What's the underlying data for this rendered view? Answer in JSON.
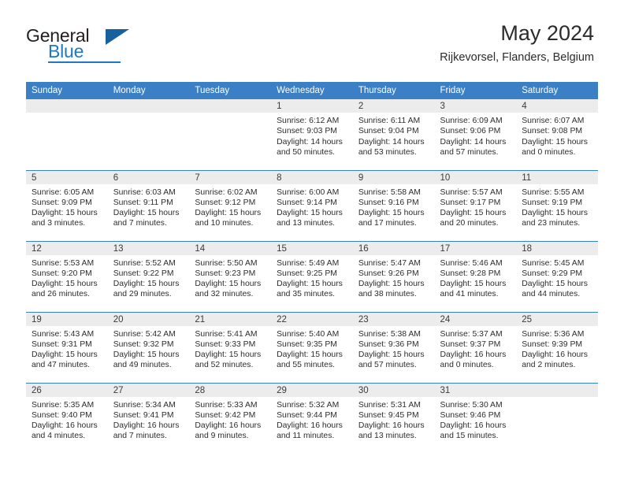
{
  "brand": {
    "name_line1": "General",
    "name_line2": "Blue",
    "logo_icon": "triangle-mark"
  },
  "header": {
    "title": "May 2024",
    "location": "Rijkevorsel, Flanders, Belgium"
  },
  "calendar": {
    "weekday_headers": [
      "Sunday",
      "Monday",
      "Tuesday",
      "Wednesday",
      "Thursday",
      "Friday",
      "Saturday"
    ],
    "header_bg": "#3b7fc4",
    "daynum_bg": "#ececec",
    "weeks": [
      [
        {
          "day": "",
          "empty": true,
          "sunrise": "",
          "sunset": "",
          "daylight_l1": "",
          "daylight_l2": ""
        },
        {
          "day": "",
          "empty": true,
          "sunrise": "",
          "sunset": "",
          "daylight_l1": "",
          "daylight_l2": ""
        },
        {
          "day": "",
          "empty": true,
          "sunrise": "",
          "sunset": "",
          "daylight_l1": "",
          "daylight_l2": ""
        },
        {
          "day": "1",
          "empty": false,
          "sunrise": "Sunrise: 6:12 AM",
          "sunset": "Sunset: 9:03 PM",
          "daylight_l1": "Daylight: 14 hours",
          "daylight_l2": "and 50 minutes."
        },
        {
          "day": "2",
          "empty": false,
          "sunrise": "Sunrise: 6:11 AM",
          "sunset": "Sunset: 9:04 PM",
          "daylight_l1": "Daylight: 14 hours",
          "daylight_l2": "and 53 minutes."
        },
        {
          "day": "3",
          "empty": false,
          "sunrise": "Sunrise: 6:09 AM",
          "sunset": "Sunset: 9:06 PM",
          "daylight_l1": "Daylight: 14 hours",
          "daylight_l2": "and 57 minutes."
        },
        {
          "day": "4",
          "empty": false,
          "sunrise": "Sunrise: 6:07 AM",
          "sunset": "Sunset: 9:08 PM",
          "daylight_l1": "Daylight: 15 hours",
          "daylight_l2": "and 0 minutes."
        }
      ],
      [
        {
          "day": "5",
          "empty": false,
          "sunrise": "Sunrise: 6:05 AM",
          "sunset": "Sunset: 9:09 PM",
          "daylight_l1": "Daylight: 15 hours",
          "daylight_l2": "and 3 minutes."
        },
        {
          "day": "6",
          "empty": false,
          "sunrise": "Sunrise: 6:03 AM",
          "sunset": "Sunset: 9:11 PM",
          "daylight_l1": "Daylight: 15 hours",
          "daylight_l2": "and 7 minutes."
        },
        {
          "day": "7",
          "empty": false,
          "sunrise": "Sunrise: 6:02 AM",
          "sunset": "Sunset: 9:12 PM",
          "daylight_l1": "Daylight: 15 hours",
          "daylight_l2": "and 10 minutes."
        },
        {
          "day": "8",
          "empty": false,
          "sunrise": "Sunrise: 6:00 AM",
          "sunset": "Sunset: 9:14 PM",
          "daylight_l1": "Daylight: 15 hours",
          "daylight_l2": "and 13 minutes."
        },
        {
          "day": "9",
          "empty": false,
          "sunrise": "Sunrise: 5:58 AM",
          "sunset": "Sunset: 9:16 PM",
          "daylight_l1": "Daylight: 15 hours",
          "daylight_l2": "and 17 minutes."
        },
        {
          "day": "10",
          "empty": false,
          "sunrise": "Sunrise: 5:57 AM",
          "sunset": "Sunset: 9:17 PM",
          "daylight_l1": "Daylight: 15 hours",
          "daylight_l2": "and 20 minutes."
        },
        {
          "day": "11",
          "empty": false,
          "sunrise": "Sunrise: 5:55 AM",
          "sunset": "Sunset: 9:19 PM",
          "daylight_l1": "Daylight: 15 hours",
          "daylight_l2": "and 23 minutes."
        }
      ],
      [
        {
          "day": "12",
          "empty": false,
          "sunrise": "Sunrise: 5:53 AM",
          "sunset": "Sunset: 9:20 PM",
          "daylight_l1": "Daylight: 15 hours",
          "daylight_l2": "and 26 minutes."
        },
        {
          "day": "13",
          "empty": false,
          "sunrise": "Sunrise: 5:52 AM",
          "sunset": "Sunset: 9:22 PM",
          "daylight_l1": "Daylight: 15 hours",
          "daylight_l2": "and 29 minutes."
        },
        {
          "day": "14",
          "empty": false,
          "sunrise": "Sunrise: 5:50 AM",
          "sunset": "Sunset: 9:23 PM",
          "daylight_l1": "Daylight: 15 hours",
          "daylight_l2": "and 32 minutes."
        },
        {
          "day": "15",
          "empty": false,
          "sunrise": "Sunrise: 5:49 AM",
          "sunset": "Sunset: 9:25 PM",
          "daylight_l1": "Daylight: 15 hours",
          "daylight_l2": "and 35 minutes."
        },
        {
          "day": "16",
          "empty": false,
          "sunrise": "Sunrise: 5:47 AM",
          "sunset": "Sunset: 9:26 PM",
          "daylight_l1": "Daylight: 15 hours",
          "daylight_l2": "and 38 minutes."
        },
        {
          "day": "17",
          "empty": false,
          "sunrise": "Sunrise: 5:46 AM",
          "sunset": "Sunset: 9:28 PM",
          "daylight_l1": "Daylight: 15 hours",
          "daylight_l2": "and 41 minutes."
        },
        {
          "day": "18",
          "empty": false,
          "sunrise": "Sunrise: 5:45 AM",
          "sunset": "Sunset: 9:29 PM",
          "daylight_l1": "Daylight: 15 hours",
          "daylight_l2": "and 44 minutes."
        }
      ],
      [
        {
          "day": "19",
          "empty": false,
          "sunrise": "Sunrise: 5:43 AM",
          "sunset": "Sunset: 9:31 PM",
          "daylight_l1": "Daylight: 15 hours",
          "daylight_l2": "and 47 minutes."
        },
        {
          "day": "20",
          "empty": false,
          "sunrise": "Sunrise: 5:42 AM",
          "sunset": "Sunset: 9:32 PM",
          "daylight_l1": "Daylight: 15 hours",
          "daylight_l2": "and 49 minutes."
        },
        {
          "day": "21",
          "empty": false,
          "sunrise": "Sunrise: 5:41 AM",
          "sunset": "Sunset: 9:33 PM",
          "daylight_l1": "Daylight: 15 hours",
          "daylight_l2": "and 52 minutes."
        },
        {
          "day": "22",
          "empty": false,
          "sunrise": "Sunrise: 5:40 AM",
          "sunset": "Sunset: 9:35 PM",
          "daylight_l1": "Daylight: 15 hours",
          "daylight_l2": "and 55 minutes."
        },
        {
          "day": "23",
          "empty": false,
          "sunrise": "Sunrise: 5:38 AM",
          "sunset": "Sunset: 9:36 PM",
          "daylight_l1": "Daylight: 15 hours",
          "daylight_l2": "and 57 minutes."
        },
        {
          "day": "24",
          "empty": false,
          "sunrise": "Sunrise: 5:37 AM",
          "sunset": "Sunset: 9:37 PM",
          "daylight_l1": "Daylight: 16 hours",
          "daylight_l2": "and 0 minutes."
        },
        {
          "day": "25",
          "empty": false,
          "sunrise": "Sunrise: 5:36 AM",
          "sunset": "Sunset: 9:39 PM",
          "daylight_l1": "Daylight: 16 hours",
          "daylight_l2": "and 2 minutes."
        }
      ],
      [
        {
          "day": "26",
          "empty": false,
          "sunrise": "Sunrise: 5:35 AM",
          "sunset": "Sunset: 9:40 PM",
          "daylight_l1": "Daylight: 16 hours",
          "daylight_l2": "and 4 minutes."
        },
        {
          "day": "27",
          "empty": false,
          "sunrise": "Sunrise: 5:34 AM",
          "sunset": "Sunset: 9:41 PM",
          "daylight_l1": "Daylight: 16 hours",
          "daylight_l2": "and 7 minutes."
        },
        {
          "day": "28",
          "empty": false,
          "sunrise": "Sunrise: 5:33 AM",
          "sunset": "Sunset: 9:42 PM",
          "daylight_l1": "Daylight: 16 hours",
          "daylight_l2": "and 9 minutes."
        },
        {
          "day": "29",
          "empty": false,
          "sunrise": "Sunrise: 5:32 AM",
          "sunset": "Sunset: 9:44 PM",
          "daylight_l1": "Daylight: 16 hours",
          "daylight_l2": "and 11 minutes."
        },
        {
          "day": "30",
          "empty": false,
          "sunrise": "Sunrise: 5:31 AM",
          "sunset": "Sunset: 9:45 PM",
          "daylight_l1": "Daylight: 16 hours",
          "daylight_l2": "and 13 minutes."
        },
        {
          "day": "31",
          "empty": false,
          "sunrise": "Sunrise: 5:30 AM",
          "sunset": "Sunset: 9:46 PM",
          "daylight_l1": "Daylight: 16 hours",
          "daylight_l2": "and 15 minutes."
        },
        {
          "day": "",
          "empty": true,
          "sunrise": "",
          "sunset": "",
          "daylight_l1": "",
          "daylight_l2": ""
        }
      ]
    ]
  }
}
